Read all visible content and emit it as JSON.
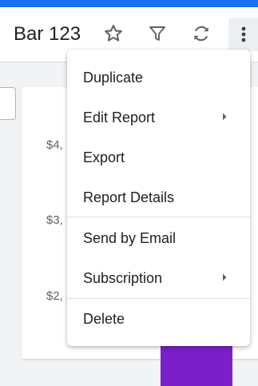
{
  "header": {
    "title": "Bar 123",
    "icons": [
      "star-icon",
      "filter-icon",
      "refresh-icon",
      "more-vertical-icon"
    ]
  },
  "chart": {
    "y_ticks": [
      "$4,",
      "$3,",
      "$2,"
    ],
    "bar_color": "#7a1fc9"
  },
  "menu": {
    "items": [
      {
        "label": "Duplicate",
        "submenu": false
      },
      {
        "label": "Edit Report",
        "submenu": true
      },
      {
        "label": "Export",
        "submenu": false
      },
      {
        "label": "Report Details",
        "submenu": false
      },
      {
        "label": "Send by Email",
        "submenu": false
      },
      {
        "label": "Subscription",
        "submenu": true
      },
      {
        "label": "Delete",
        "submenu": false
      }
    ]
  },
  "colors": {
    "accent": "#1a73e8",
    "icon": "#5f6368"
  }
}
